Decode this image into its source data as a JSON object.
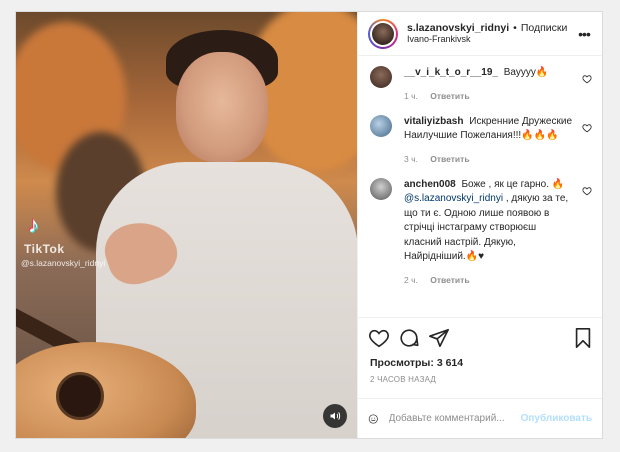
{
  "media": {
    "watermark_logo": "♪",
    "watermark_word": "TikTok",
    "watermark_user": "@s.lazanovskyi_ridnyi"
  },
  "header": {
    "username": "s.lazanovskyi_ridnyi",
    "separator": "•",
    "follow_label": "Подписки",
    "location": "Ivano-Frankivsk",
    "more": "•••"
  },
  "comments": [
    {
      "user": "__v_i_k_t_o_r__19_",
      "text": "Вауууу🔥",
      "time": "1 ч.",
      "reply": "Ответить",
      "avatar_color": "#6b4a3a"
    },
    {
      "user": "vitaliyizbash",
      "text": "Искренние Дружеские Наилучшие Пожелания!!!🔥🔥🔥",
      "time": "3 ч.",
      "reply": "Ответить",
      "avatar_color": "#7f9bb5"
    },
    {
      "user": "anchen008",
      "text_before": "Боже , як це гарно. 🔥",
      "mention": "@s.lazanovskyi_ridnyi",
      "text_after": " , дякую за те, що ти є. Одною лише появою в стрічці інстаграму створюєш класний настрій. Дякую, Найрідніший.🔥♥",
      "time": "2 ч.",
      "reply": "Ответить",
      "avatar_color": "#9a9a9a"
    }
  ],
  "stats": {
    "views_label": "Просмотры:",
    "views_value": "3 614",
    "posted": "2 часов назад"
  },
  "composer": {
    "placeholder": "Добавьте комментарий...",
    "publish_label": "Опубликовать"
  }
}
